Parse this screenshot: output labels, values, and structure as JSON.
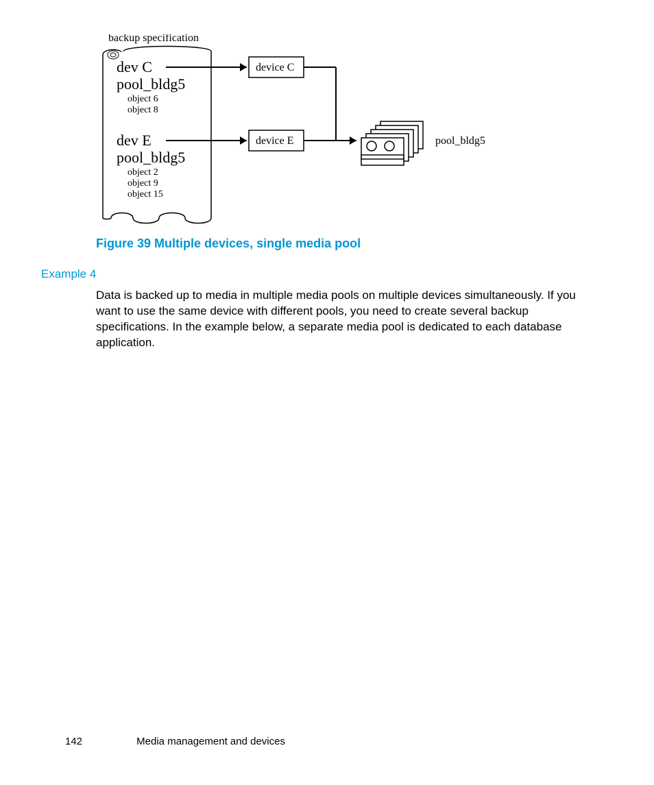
{
  "diagram": {
    "title": "backup specification",
    "block1": {
      "dev": "dev C",
      "pool": "pool_bldg5",
      "objects": [
        "object 6",
        "object 8"
      ]
    },
    "block2": {
      "dev": "dev E",
      "pool": "pool_bldg5",
      "objects": [
        "object 2",
        "object 9",
        "object 15"
      ]
    },
    "device1": "device C",
    "device2": "device E",
    "poolLabel": "pool_bldg5"
  },
  "caption": "Figure 39 Multiple devices, single media pool",
  "exampleLabel": "Example 4",
  "bodyText": "Data is backed up to media in multiple media pools on multiple devices simultaneously. If you want to use the same device with different pools, you need to create several backup specifications. In the example below, a separate media pool is dedicated to each database application.",
  "footer": {
    "pageNumber": "142",
    "section": "Media management and devices"
  }
}
